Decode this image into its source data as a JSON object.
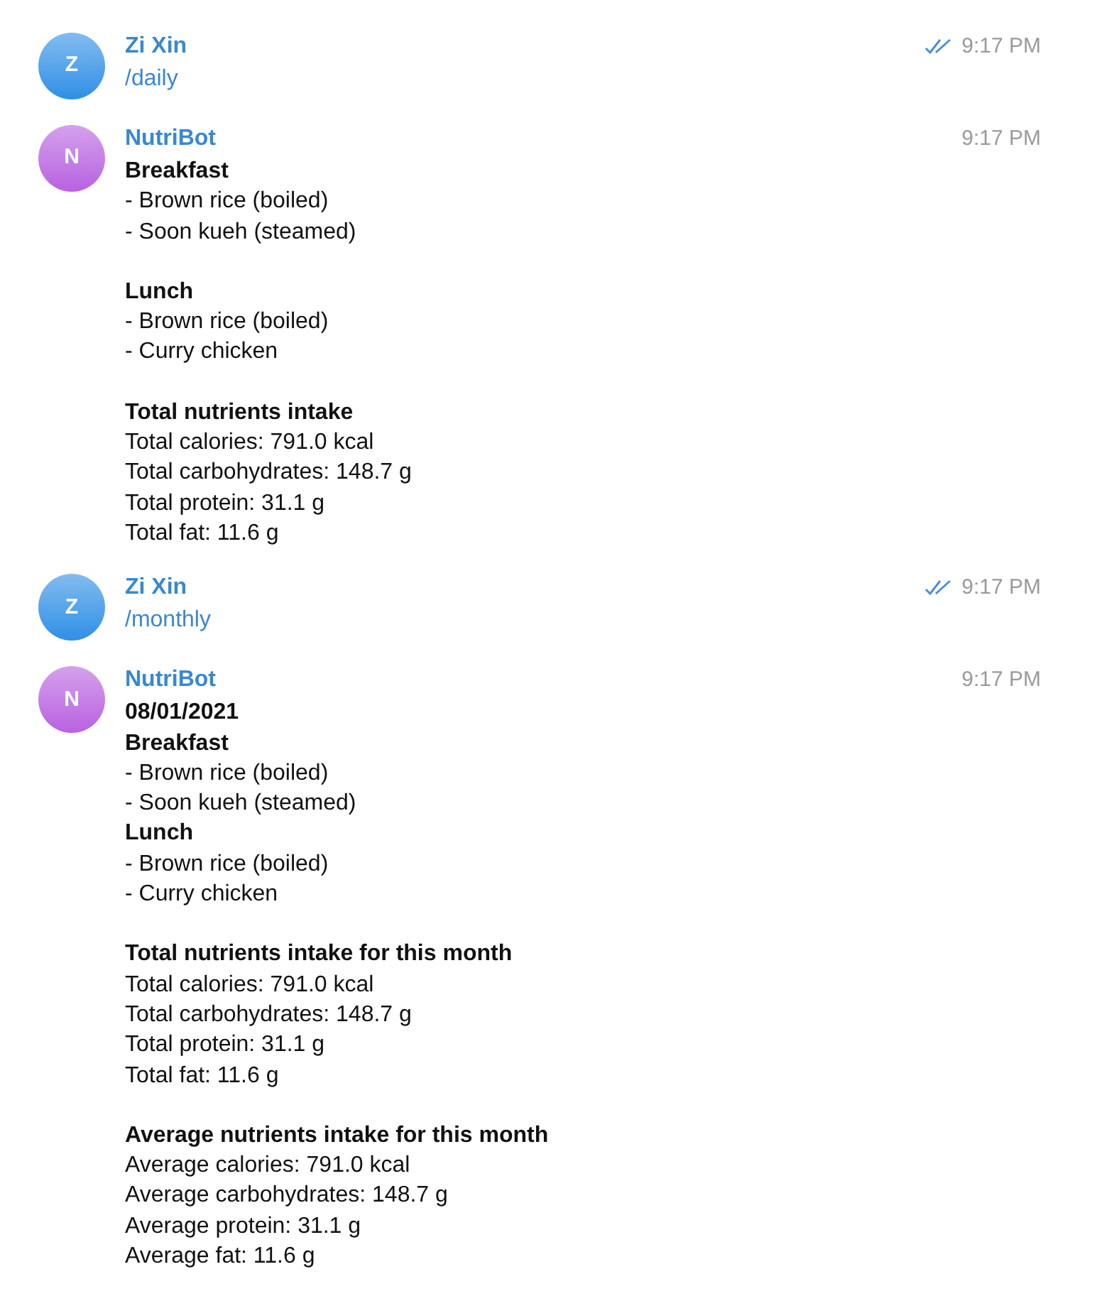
{
  "messages": [
    {
      "sender": "Zi Xin",
      "avatar_letter": "Z",
      "color": "#2f8fe6",
      "time": "9:17 PM",
      "read_receipt": true,
      "blocks": [
        [
          {
            "text": "/daily",
            "kind": "command"
          }
        ]
      ]
    },
    {
      "sender": "NutriBot",
      "avatar_letter": "N",
      "color": "#b862e0",
      "time": "9:17 PM",
      "read_receipt": false,
      "blocks": [
        [
          {
            "text": "Breakfast",
            "kind": "heading"
          },
          {
            "text": "- Brown rice (boiled)",
            "kind": "plain"
          },
          {
            "text": "- Soon kueh (steamed)",
            "kind": "plain"
          }
        ],
        [
          {
            "text": "Lunch",
            "kind": "heading"
          },
          {
            "text": "- Brown rice (boiled)",
            "kind": "plain"
          },
          {
            "text": "- Curry chicken",
            "kind": "plain"
          }
        ],
        [
          {
            "text": "Total nutrients intake",
            "kind": "heading"
          },
          {
            "text": "Total calories: 791.0 kcal",
            "kind": "plain"
          },
          {
            "text": "Total carbohydrates: 148.7 g",
            "kind": "plain"
          },
          {
            "text": "Total protein: 31.1 g",
            "kind": "plain"
          },
          {
            "text": "Total fat: 11.6 g",
            "kind": "plain"
          }
        ]
      ]
    },
    {
      "sender": "Zi Xin",
      "avatar_letter": "Z",
      "color": "#2f8fe6",
      "time": "9:17 PM",
      "read_receipt": true,
      "blocks": [
        [
          {
            "text": "/monthly",
            "kind": "command"
          }
        ]
      ]
    },
    {
      "sender": "NutriBot",
      "avatar_letter": "N",
      "color": "#b862e0",
      "time": "9:17 PM",
      "read_receipt": false,
      "blocks": [
        [
          {
            "text": "08/01/2021",
            "kind": "heading"
          },
          {
            "text": "Breakfast",
            "kind": "heading"
          },
          {
            "text": "- Brown rice (boiled)",
            "kind": "plain"
          },
          {
            "text": "- Soon kueh (steamed)",
            "kind": "plain"
          },
          {
            "text": "Lunch",
            "kind": "heading"
          },
          {
            "text": "- Brown rice (boiled)",
            "kind": "plain"
          },
          {
            "text": "- Curry chicken",
            "kind": "plain"
          }
        ],
        [
          {
            "text": "Total nutrients intake for this month",
            "kind": "heading"
          },
          {
            "text": "Total calories: 791.0 kcal",
            "kind": "plain"
          },
          {
            "text": "Total carbohydrates: 148.7 g",
            "kind": "plain"
          },
          {
            "text": "Total protein: 31.1 g",
            "kind": "plain"
          },
          {
            "text": "Total fat: 11.6 g",
            "kind": "plain"
          }
        ],
        [
          {
            "text": "Average nutrients intake for this month",
            "kind": "heading"
          },
          {
            "text": "Average calories: 791.0 kcal",
            "kind": "plain"
          },
          {
            "text": "Average carbohydrates: 148.7 g",
            "kind": "plain"
          },
          {
            "text": "Average protein: 31.1 g",
            "kind": "plain"
          },
          {
            "text": "Average fat: 11.6 g",
            "kind": "plain"
          }
        ]
      ]
    }
  ]
}
